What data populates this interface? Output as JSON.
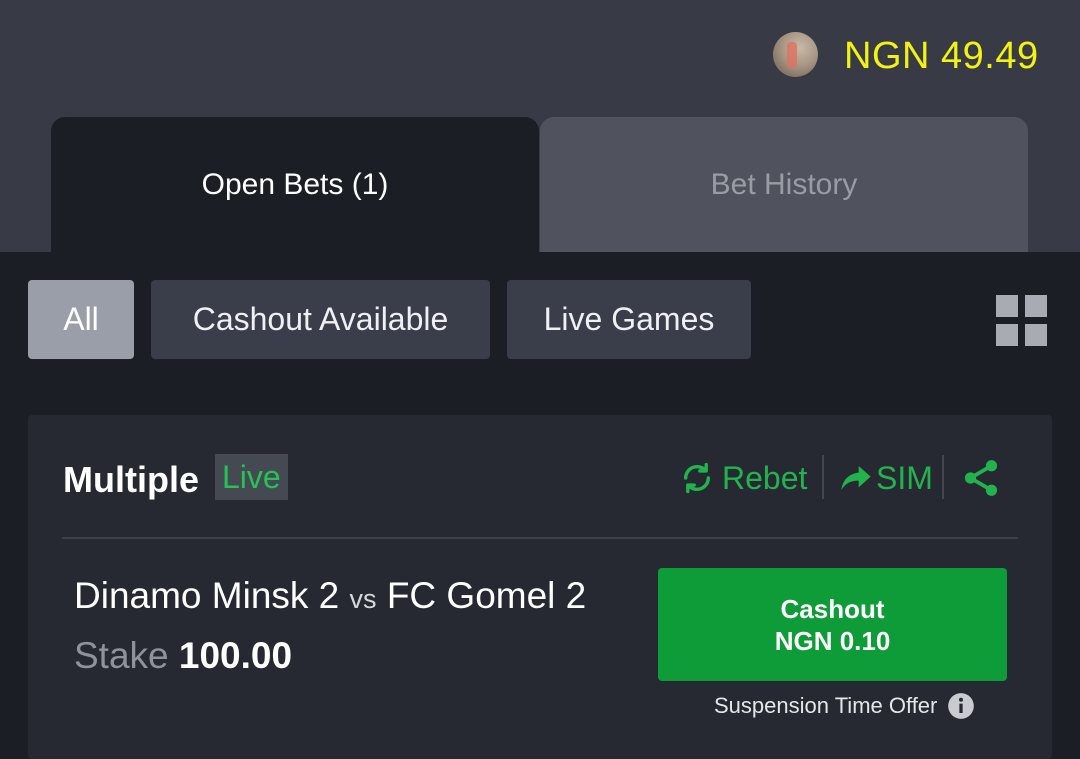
{
  "header": {
    "balance": "NGN 49.49",
    "balance_color": "#f2f213",
    "avatar_icon": "user-avatar"
  },
  "tabs": [
    {
      "label": "Open Bets (1)",
      "active": true
    },
    {
      "label": "Bet History",
      "active": false
    }
  ],
  "filters": [
    {
      "label": "All",
      "active": true
    },
    {
      "label": "Cashout Available",
      "active": false
    },
    {
      "label": "Live Games",
      "active": false
    }
  ],
  "view_toggle_icon": "grid-icon",
  "bet": {
    "type": "Multiple",
    "status_badge": "Live",
    "actions": {
      "rebet": "Rebet",
      "sim": "SIM",
      "share_icon": "share-icon"
    },
    "match": {
      "home": "Dinamo Minsk 2",
      "vs": "vs",
      "away": "FC Gomel 2"
    },
    "stake_label": "Stake",
    "stake_value": "100.00",
    "cashout": {
      "label": "Cashout",
      "amount": "NGN 0.10"
    },
    "suspension_text": "Suspension Time Offer",
    "accent_color": "#22b34d"
  }
}
